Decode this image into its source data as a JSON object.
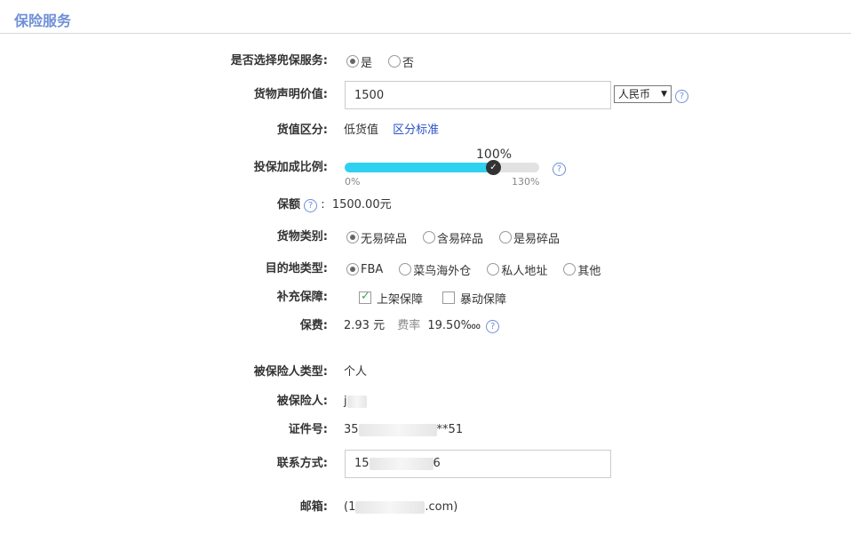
{
  "section": {
    "title": "保险服务"
  },
  "insurance_choice": {
    "label": "是否选择兜保服务:",
    "options": [
      {
        "label": "是",
        "checked": true
      },
      {
        "label": "否",
        "checked": false
      }
    ]
  },
  "declared_value": {
    "label": "货物声明价值:",
    "value": "1500",
    "currency": "人民币",
    "help": "?"
  },
  "value_class": {
    "label": "货值区分:",
    "value": "低货值",
    "link": "区分标准"
  },
  "ratio": {
    "label": "投保加成比例:",
    "value_text": "100%",
    "min_label": "0%",
    "max_label": "130%",
    "value": 100,
    "min": 0,
    "max": 130,
    "help": "?"
  },
  "coverage": {
    "label": "保额",
    "help": "?",
    "colon": ":",
    "value": "1500.00元"
  },
  "cargo_type": {
    "label": "货物类别:",
    "options": [
      {
        "label": "无易碎品",
        "checked": true
      },
      {
        "label": "含易碎品",
        "checked": false
      },
      {
        "label": "是易碎品",
        "checked": false
      }
    ]
  },
  "destination": {
    "label": "目的地类型:",
    "options": [
      {
        "label": "FBA",
        "checked": true
      },
      {
        "label": "菜鸟海外仓",
        "checked": false
      },
      {
        "label": "私人地址",
        "checked": false
      },
      {
        "label": "其他",
        "checked": false
      }
    ]
  },
  "supplement": {
    "label": "补充保障:",
    "options": [
      {
        "label": "上架保障",
        "checked": true
      },
      {
        "label": "暴动保障",
        "checked": false
      }
    ]
  },
  "premium": {
    "label": "保费:",
    "amount": "2.93 元",
    "rate_label": "费率",
    "rate": "19.50‱",
    "help": "?"
  },
  "insured_type": {
    "label": "被保险人类型:",
    "value": "个人"
  },
  "insured": {
    "label": "被保险人:",
    "value_start": "j",
    "value_end": ""
  },
  "id_number": {
    "label": "证件号:",
    "value_start": "35",
    "value_end": "**51"
  },
  "contact": {
    "label": "联系方式:",
    "value_start": "15",
    "value_end": "6"
  },
  "email": {
    "label": "邮箱:",
    "value_start": "(1",
    "value_end": ".com)"
  },
  "colors": {
    "accent": "#6f8fd8",
    "slider_fill": "#2fd1f1",
    "link": "#2a52c9"
  }
}
